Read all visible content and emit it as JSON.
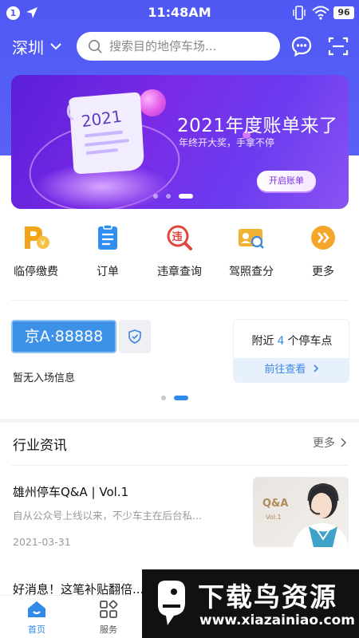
{
  "status_bar": {
    "notification_count": "1",
    "time": "11:48AM",
    "battery": "96"
  },
  "header": {
    "city": "深圳",
    "search_placeholder": "搜索目的地停车场...",
    "icons": [
      "chat-icon",
      "scan-icon"
    ]
  },
  "banner": {
    "year_text": "2021",
    "title": "2021年度账单来了",
    "subtitle": "年终开大奖，手拿不停",
    "button": "开启账单",
    "page_count": 3,
    "active_page": 2
  },
  "quick_actions": [
    {
      "label": "临停缴费",
      "icon": "parking-pay-icon"
    },
    {
      "label": "订单",
      "icon": "order-icon"
    },
    {
      "label": "违章查询",
      "icon": "violation-icon"
    },
    {
      "label": "驾照查分",
      "icon": "license-icon"
    },
    {
      "label": "更多",
      "icon": "more-icon"
    }
  ],
  "vehicle": {
    "plate": "京A·88888",
    "entry_status": "暂无入场信息"
  },
  "nearby": {
    "prefix": "附近",
    "count": "4",
    "suffix": "个停车点",
    "button": "前往查看"
  },
  "news": {
    "title": "行业资讯",
    "more": "更多",
    "articles": [
      {
        "title": "雄州停车Q&A | Vol.1",
        "desc": "自从公众号上线以来，不少车主在后台私...",
        "date": "2021-03-31",
        "thumb_title": "Q&A",
        "thumb_sub": "Vol.1"
      },
      {
        "title": "好消息！这笔补贴翻倍..."
      }
    ]
  },
  "tabbar": {
    "tabs": [
      {
        "label": "首页",
        "active": true
      },
      {
        "label": "服务",
        "active": false
      }
    ]
  },
  "watermark": {
    "name": "下载鸟资源",
    "url": "www.xiazainiao.com"
  },
  "colors": {
    "header_blue": "#4f58f3",
    "plate_blue": "#3d92e8",
    "link_blue": "#3d86e6",
    "banner_purple": "#6b2ae6"
  }
}
